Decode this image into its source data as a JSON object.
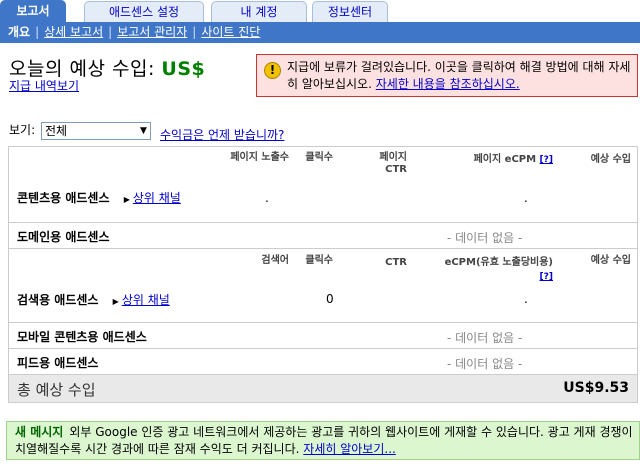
{
  "tabs": [
    "보고서",
    "애드센스 설정",
    "내 계정",
    "정보센터"
  ],
  "subnav": {
    "current": "개요",
    "links": [
      "상세 보고서",
      "보고서 관리자",
      "사이트 진단"
    ]
  },
  "header": {
    "title_prefix": "오늘의 예상 수입:",
    "title_amount": "US$",
    "history_link": "지급 내역보기"
  },
  "alert": {
    "icon": "!",
    "text": "지급에 보류가 걸려있습니다. 이곳을 클릭하여 해결 방법에 대해 자세히 알아보십시오.",
    "link": "자세한 내용을 참조하십시오."
  },
  "filter": {
    "label": "보기:",
    "selected": "전체",
    "help_link": "수익금은 언제 받습니까?"
  },
  "content_section": {
    "headers": [
      "페이지 노출수",
      "클릭수",
      "페이지 CTR",
      "페이지 eCPM",
      "예상 수입"
    ],
    "help": "[?]",
    "name": "콘텐츠용 애드센스",
    "sub_link": "상위 채널",
    "dots": [
      ".",
      "."
    ]
  },
  "domain_section": {
    "name": "도메인용 애드센스",
    "nodata": "- 데이터 없음 -"
  },
  "search_section": {
    "headers": [
      "검색어",
      "클릭수",
      "CTR",
      "eCPM(유효 노출당비용)",
      "예상 수입"
    ],
    "help": "[?]",
    "name": "검색용 애드센스",
    "sub_link": "상위 채널",
    "clicks": "0",
    "dot": "."
  },
  "mobile_section": {
    "name": "모바일 콘텐츠용 애드센스",
    "nodata": "- 데이터 없음 -"
  },
  "feed_section": {
    "name": "피드용 애드센스",
    "nodata": "- 데이터 없음 -"
  },
  "total": {
    "label": "총 예상 수입",
    "value": "US$9.53"
  },
  "news": {
    "tag": "새 메시지",
    "text": "외부 Google 인증 광고 네트워크에서 제공하는 광고를 귀하의 웹사이트에 게재할 수 있습니다. 광고 게재 경쟁이 치열해질수록 시간 경과에 따른 잠재 수익도 더 커집니다.",
    "link": "자세히 알아보기..."
  }
}
